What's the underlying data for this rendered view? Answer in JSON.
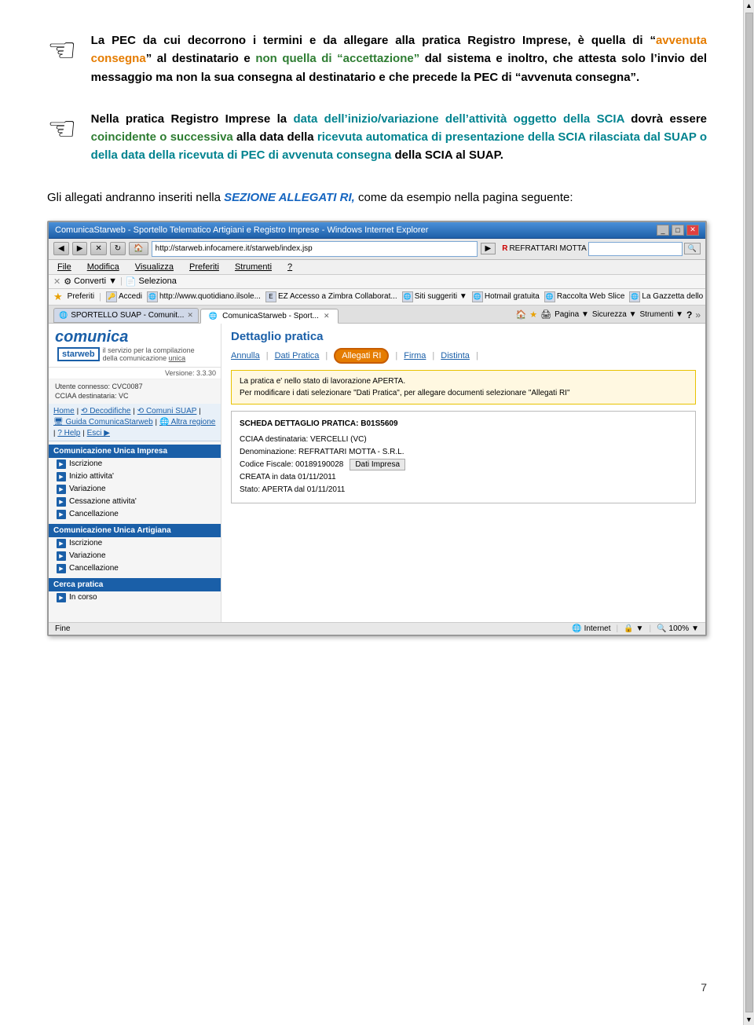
{
  "section1": {
    "text_before_orange": "La PEC da cui decorrono i termini e da allegare alla pratica Registro Imprese, è quella di “",
    "orange_text": "avvenuta consegna",
    "text_after_orange": "” al destinatario e ",
    "green_text": "non quella di “accettazione”",
    "text_after_green": " dal sistema e inoltro, che attesta solo l’invio del messaggio ma non la sua consegna al destinatario e che precede la PEC di “avvenuta consegna”."
  },
  "section2": {
    "text_before_cyan": "Nella pratica Registro Imprese la ",
    "cyan_text": "data dell’inizio/variazione dell’attività oggetto della SCIA",
    "text_bold": " dovrà essere ",
    "green_text2": "coincidente o successiva",
    "text_mid": " alla data della ",
    "cyan_text2": "ricevuta automatica di presentazione della SCIA rilasciata dal SUAP o della data",
    "text_after": " ",
    "blue_text": "della ricevuta di PEC di avvenuta consegna",
    "text_end": " della SCIA al SUAP."
  },
  "allegati": {
    "before_link": "Gli allegati andranno inseriti nella ",
    "link_text": "SEZIONE ALLEGATI RI,",
    "after_link": " come da esempio nella pagina seguente:"
  },
  "browser": {
    "title": "ComunicaStarweb - Sportello Telematico Artigiani e Registro Imprese - Windows Internet Explorer",
    "address": "http://starweb.infocamere.it/starweb/index.jsp",
    "menu_items": [
      "File",
      "Modifica",
      "Visualizza",
      "Preferiti",
      "Strumenti",
      "?"
    ],
    "toolbar_items": [
      "Converti",
      "Seleziona"
    ],
    "favorites_label": "Preferiti",
    "fav_items": [
      "Accedi",
      "http://www.quotidiano.ilsole...",
      "EZ Accesso a Zimbra Collaborat...",
      "Siti suggeriti",
      "Hotmail gratuita",
      "Raccolta Web Slice",
      "La Gazzetta dello Sport.it"
    ],
    "tabs": [
      "SPORTELLO SUAP - Comunit...",
      "ComunicaStarweb - Sport..."
    ],
    "versione": "Versione: 3.3.30",
    "user_line1": "Utente connesso: CVC0087",
    "user_line2": "CCIAA destinataria: VC",
    "nav_links": [
      "Home",
      "Decodifiche",
      "Comuni SUAP",
      "Guida ComunicaStarweb",
      "Altra regione",
      "Help",
      "Esci"
    ],
    "sidebar": {
      "section1_title": "Comunicazione Unica Impresa",
      "section1_items": [
        "Iscrizione",
        "Inizio attivita'",
        "Variazione",
        "Cessazione attivita'",
        "Cancellazione"
      ],
      "section2_title": "Comunicazione Unica Artigiana",
      "section2_items": [
        "Iscrizione",
        "Variazione",
        "Cancellazione"
      ],
      "section3_title": "Cerca pratica",
      "section3_items": [
        "In corso"
      ]
    },
    "detail": {
      "title": "Dettaglio pratica",
      "nav_links": [
        "Annulla",
        "Dati Pratica",
        "Allegati RI",
        "Firma",
        "Distinta"
      ],
      "alert_text1": "La pratica e' nello stato di lavorazione APERTA.",
      "alert_text2": "Per modificare i dati selezionare \"Dati Pratica\", per allegare documenti selezionare \"Allegati RI\"",
      "scheda_title": "SCHEDA DETTAGLIO PRATICA: B01S5609",
      "cciaa": "CCIAA destinataria: VERCELLI (VC)",
      "denominazione": "Denominazione: REFRATTARI MOTTA - S.R.L.",
      "codice_label": "Codice Fiscale: 00189190028",
      "dati_btn": "Dati Impresa",
      "creata": "CREATA in data 01/11/2011",
      "stato": "Stato: APERTA dal 01/11/2011"
    },
    "status_bar": {
      "left": "Fine",
      "right_zone": "Internet",
      "zoom": "100%"
    }
  },
  "page_number": "7"
}
